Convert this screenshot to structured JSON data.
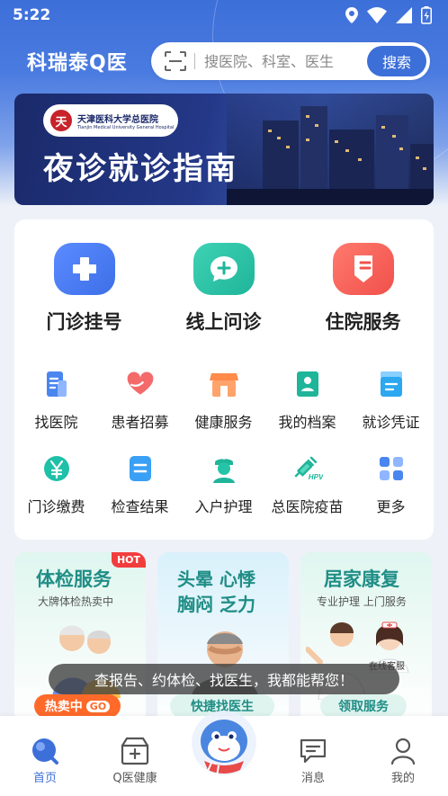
{
  "status_bar": {
    "time": "5:22"
  },
  "header": {
    "logo": "科瑞泰Q医",
    "search_placeholder": "搜医院、科室、医生",
    "search_button": "搜索"
  },
  "banner": {
    "hospital_cn": "天津医科大学总医院",
    "hospital_en": "Tianjin Medical University General Hospital",
    "title": "夜诊就诊指南"
  },
  "main_services": [
    {
      "label": "门诊挂号",
      "icon": "plus-cross-icon",
      "color": "#3d6fe8"
    },
    {
      "label": "线上问诊",
      "icon": "chat-plus-icon",
      "color": "#1fb59a"
    },
    {
      "label": "住院服务",
      "icon": "bed-icon",
      "color": "#f0504a"
    }
  ],
  "sub_services": [
    {
      "label": "找医院",
      "icon": "hospital-doc-icon"
    },
    {
      "label": "患者招募",
      "icon": "heart-hand-icon"
    },
    {
      "label": "健康服务",
      "icon": "store-icon"
    },
    {
      "label": "我的档案",
      "icon": "profile-book-icon"
    },
    {
      "label": "就诊凭证",
      "icon": "voucher-icon"
    },
    {
      "label": "门诊缴费",
      "icon": "yen-icon"
    },
    {
      "label": "检查结果",
      "icon": "report-icon"
    },
    {
      "label": "入户护理",
      "icon": "nurse-icon"
    },
    {
      "label": "总医院疫苗",
      "icon": "hpv-syringe-icon"
    },
    {
      "label": "更多",
      "icon": "grid-icon"
    }
  ],
  "promos": [
    {
      "title": "体检服务",
      "subtitle": "大牌体检热卖中",
      "badge": "HOT",
      "button": "热卖中",
      "button_tag": "GO"
    },
    {
      "title_line1": "头晕 心悸",
      "title_line2": "胸闷 乏力",
      "button": "快捷找医生"
    },
    {
      "title": "居家康复",
      "subtitle": "专业护理 上门服务",
      "button": "领取服务"
    }
  ],
  "assistant": {
    "tip": "查报告、约体检、找医生，我都能帮您！",
    "online_service": "在线客服"
  },
  "bottom_nav": [
    {
      "label": "首页",
      "icon": "home-q-icon",
      "active": true
    },
    {
      "label": "Q医健康",
      "icon": "health-box-icon",
      "active": false
    },
    {
      "label": "消息",
      "icon": "message-icon",
      "active": false
    },
    {
      "label": "我的",
      "icon": "user-icon",
      "active": false
    }
  ],
  "colors": {
    "primary": "#3d6fd9",
    "teal": "#1f8e86",
    "hot": "#f23d3d"
  }
}
